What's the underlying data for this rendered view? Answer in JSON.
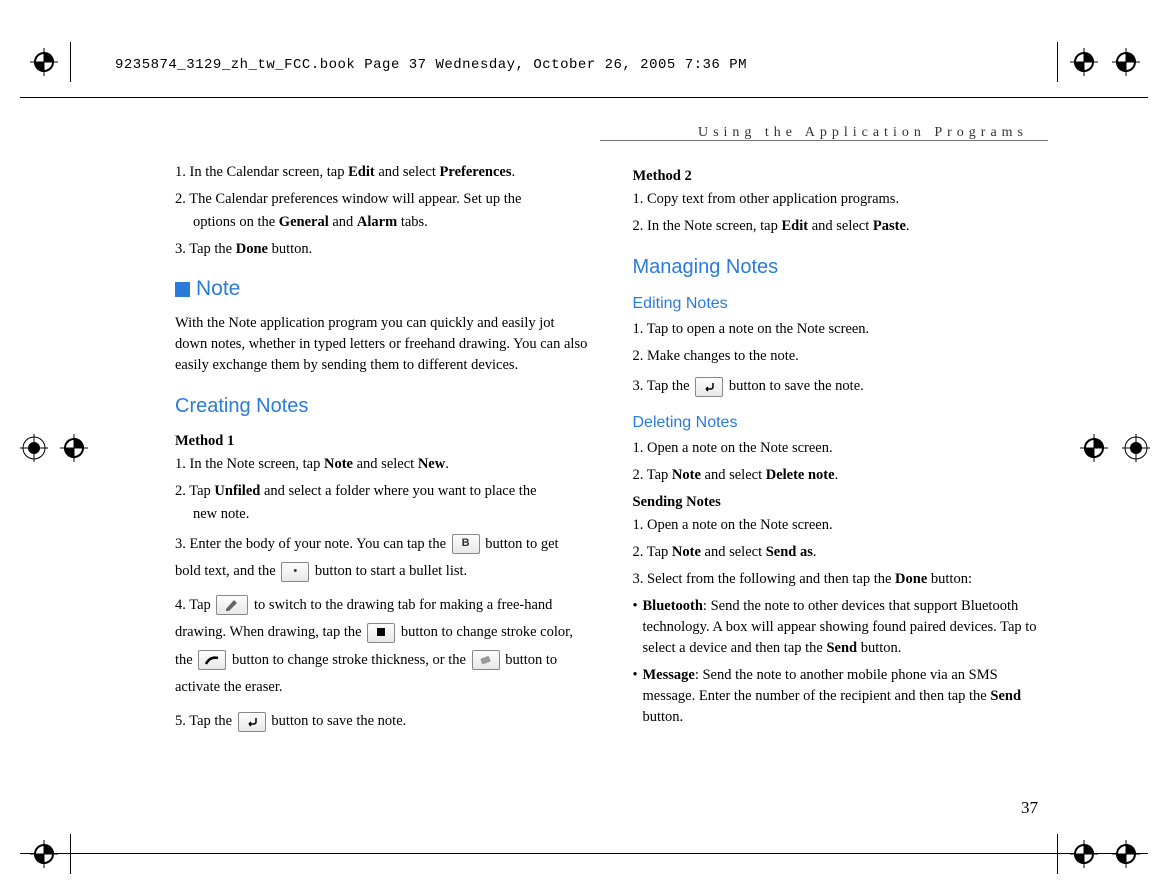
{
  "header": "9235874_3129_zh_tw_FCC.book  Page 37  Wednesday, October 26, 2005  7:36 PM",
  "section_header": "Using the Application Programs",
  "page_number": "37",
  "left": {
    "intro_steps": [
      {
        "pre": "1. In the Calendar screen, tap ",
        "b1": "Edit",
        "mid": " and select ",
        "b2": "Preferences",
        "post": "."
      },
      {
        "pre": "2. The Calendar preferences window will appear. Set up the options on the ",
        "b1": "General",
        "mid": " and ",
        "b2": "Alarm",
        "post": " tabs."
      },
      {
        "pre": "3. Tap the ",
        "b1": "Done",
        "mid": " button.",
        "b2": "",
        "post": ""
      }
    ],
    "note_heading": "Note",
    "note_body": "With the Note application program you can quickly and easily jot down notes, whether in typed letters or freehand drawing. You can also easily exchange them by sending them to different devices.",
    "creating_heading": "Creating Notes",
    "method1_label": "Method 1",
    "m1_step1": {
      "pre": "1. In the Note screen, tap ",
      "b1": "Note",
      "mid": " and select ",
      "b2": "New",
      "post": "."
    },
    "m1_step2": {
      "pre": "2. Tap ",
      "b1": "Unfiled",
      "mid": " and select a folder where you want to place the new note.",
      "b2": "",
      "post": ""
    },
    "m1_step3_a": "3. Enter the body of your note. You can tap the ",
    "m1_step3_b": " button to get bold text, and the ",
    "m1_step3_c": " button to start a bullet list.",
    "m1_step4_a": "4. Tap ",
    "m1_step4_b": " to switch to the drawing tab for making a free-hand drawing. When drawing, tap the ",
    "m1_step4_c": " button to change stroke color, the ",
    "m1_step4_d": " button to change stroke thickness, or the ",
    "m1_step4_e": " button to activate the eraser.",
    "m1_step5_a": "5. Tap the ",
    "m1_step5_b": " button to save the note."
  },
  "right": {
    "method2_label": "Method 2",
    "m2_step1": "1. Copy text from other application programs.",
    "m2_step2": {
      "pre": "2. In the Note screen, tap ",
      "b1": "Edit",
      "mid": " and select ",
      "b2": "Paste",
      "post": "."
    },
    "managing_heading": "Managing Notes",
    "editing_heading": "Editing Notes",
    "e_step1": "1. Tap to open a note on the Note screen.",
    "e_step2": "2. Make changes to the note.",
    "e_step3_a": "3. Tap the ",
    "e_step3_b": " button to save the note.",
    "deleting_heading": "Deleting Notes",
    "d_step1": "1. Open a note on the Note screen.",
    "d_step2": {
      "pre": "2. Tap ",
      "b1": "Note",
      "mid": " and select ",
      "b2": "Delete note",
      "post": "."
    },
    "sending_heading": "Sending Notes",
    "s_step1": "1. Open a note on the Note screen.",
    "s_step2": {
      "pre": "2. Tap ",
      "b1": "Note",
      "mid": " and select ",
      "b2": "Send as",
      "post": "."
    },
    "s_step3": {
      "pre": "3. Select from the following and then tap the ",
      "b1": "Done",
      "mid": " button:",
      "b2": "",
      "post": ""
    },
    "s_bt": {
      "b": "Bluetooth",
      "txt": ": Send the note to other devices that support Bluetooth technology. A box will appear showing found paired devices. Tap to select a device and then tap the ",
      "b2": "Send",
      "post": " button."
    },
    "s_msg": {
      "b": "Message",
      "txt": ": Send the note to another mobile phone via an SMS message. Enter the number of the recipient and then tap the ",
      "b2": "Send",
      "post": " button."
    }
  },
  "icons": {
    "bold": "B",
    "bullet": "•",
    "pencil": "pencil",
    "square": "■",
    "thickness": "thickness",
    "eraser": "eraser",
    "back": "↶"
  }
}
